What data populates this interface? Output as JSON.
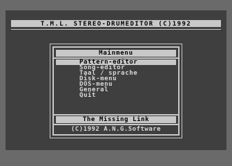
{
  "app": {
    "title": "T.M.L. STEREO-DRUMEDITOR (C)1992"
  },
  "dialog": {
    "header": "Mainmenu",
    "menu_items": [
      {
        "label": "Pattern-editor",
        "selected": true
      },
      {
        "label": "Song-editor",
        "selected": false
      },
      {
        "label": "Taal / sprache",
        "selected": false
      },
      {
        "label": "Disk-menu",
        "selected": false
      },
      {
        "label": "DOS-menu",
        "selected": false
      },
      {
        "label": "General",
        "selected": false
      },
      {
        "label": "Quit",
        "selected": false
      }
    ],
    "footer": "The Missing Link",
    "copyright": "(C)1992 A.N.G.Software"
  },
  "colors": {
    "border": "#6a6a6a",
    "background": "#3f3f3f",
    "foreground": "#c8c8c8"
  }
}
